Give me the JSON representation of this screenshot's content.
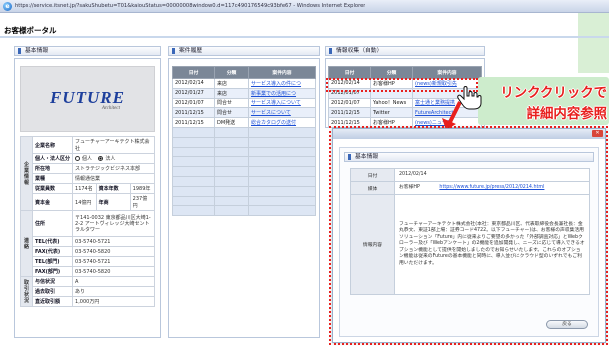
{
  "window": {
    "title": "https://service.itsnet.jp/?sakuShubetu=T01&kaiouStatus=00000008window0.d=117c490176549c93bfe67 - Windows Internet Explorer"
  },
  "portal": {
    "title": "お客様ポータル"
  },
  "basic": {
    "heading": "基本情報",
    "logo": {
      "main": "FUTURE",
      "sub": "Architect"
    },
    "categories": {
      "kihon": "企業情報",
      "renraku": "連絡",
      "torihiki": "取引状況"
    },
    "rows": [
      {
        "label": "企業名称",
        "value": "フューチャーアーキテクト株式会社"
      },
      {
        "label": "個人・法人区分",
        "opt1": "個人",
        "opt2": "法人"
      },
      {
        "label": "所在地",
        "value": "ストラテジックビジネス本部"
      },
      {
        "label": "業種",
        "value": "情報通信業"
      },
      {
        "label": "従業員数",
        "value": "1174名",
        "label2": "資本年数",
        "value2": "1989年"
      },
      {
        "label": "資本金",
        "value": "14億円",
        "label2": "年商",
        "value2": "237億円"
      },
      {
        "label": "住所",
        "value": "〒141-0032 東京都品川区大崎1-2-2 アートヴィレッジ大崎セントラルタワー"
      },
      {
        "label": "TEL(代表)",
        "value": "03-5740-5721"
      },
      {
        "label": "FAX(代表)",
        "value": "03-5740-5820"
      },
      {
        "label": "TEL(部門)",
        "value": "03-5740-5721"
      },
      {
        "label": "FAX(部門)",
        "value": "03-5740-5820"
      },
      {
        "label": "与信状況",
        "value": "A"
      },
      {
        "label": "過去取引",
        "value": "あり"
      },
      {
        "label": "直近取引額",
        "value": "1,000万円"
      }
    ]
  },
  "history": {
    "heading": "案件履歴",
    "columns": [
      "日付",
      "分類",
      "案件内容"
    ],
    "rows": [
      {
        "date": "2012/02/14",
        "type": "来店",
        "content": "サービス導入の件につ"
      },
      {
        "date": "2012/01/27",
        "type": "来店",
        "content": "新事業での活用につ"
      },
      {
        "date": "2012/01/07",
        "type": "問合せ",
        "content": "サービス導入について"
      },
      {
        "date": "2011/12/15",
        "type": "問合せ",
        "content": "サービスについて"
      },
      {
        "date": "2011/12/15",
        "type": "DM発送",
        "content": "総合カタログの送付"
      }
    ]
  },
  "collect": {
    "heading": "情報収集（自動）",
    "columns": [
      "日付",
      "分類",
      "案件内容"
    ],
    "rows": [
      {
        "date": "2012/02/14",
        "type": "お客様HP",
        "content": "(news)新規取引先"
      },
      {
        "date": "2012/01/07",
        "type": "",
        "content": ""
      },
      {
        "date": "2012/01/07",
        "type": "Yahoo！News",
        "content": "富士通と業務提携"
      },
      {
        "date": "2011/12/15",
        "type": "Twitter",
        "content": "FutureArchitect"
      },
      {
        "date": "2011/12/15",
        "type": "お客様HP",
        "content": "(news)ニュース"
      }
    ]
  },
  "callout": {
    "line1": "リンククリックで",
    "line2": "詳細内容参照"
  },
  "popup": {
    "heading": "基本情報",
    "date_label": "日付",
    "date_value": "2012/02/14",
    "media_label": "媒体",
    "media_value": "お客様HP",
    "link": "https://www.future.jp/press/2012/0214.html",
    "info_label": "情報内容",
    "info_value": "フューチャーアーキテクト株式会社(本社：東京都品川区、代表取締役会長兼社長：金丸恭文、東証1部上場：証券コード4722。以下フューチャー)は、お客様の声収集活用ソリューション「Future」内に従来よりご要望の多かった「外部調査対応」とWebクローラー及び「Webアンケート」の2機能を追加開発し、ニーズに応じて導入できるオプション機能として提供を開始しましたのでお知らせいたします。これらのオプション機能は従来のFutureの基本機能と同時に、導入並びにクラウド型のいずれでもご利用いただけます。",
    "back_label": "戻る"
  }
}
